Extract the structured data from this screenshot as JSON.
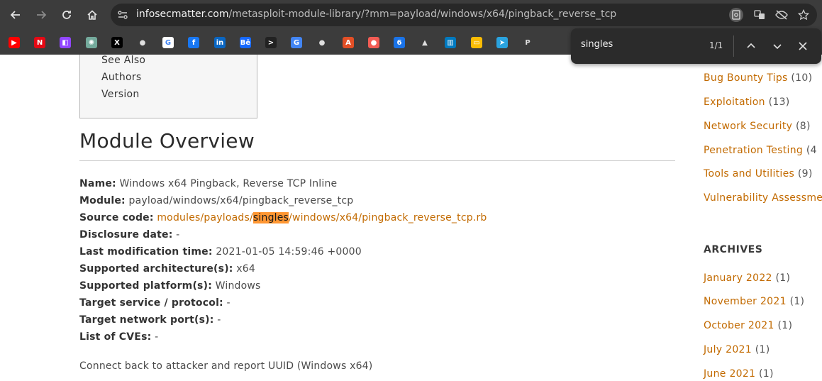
{
  "browser": {
    "url_host": "infosecmatter.com",
    "url_path": "/metasploit-module-library/?mm=payload/windows/x64/pingback_reverse_tcp",
    "bookmarks": [
      {
        "icon": "youtube-icon",
        "color": "#ff0000",
        "glyph": "▶"
      },
      {
        "icon": "netflix-icon",
        "color": "#e50914",
        "glyph": "N"
      },
      {
        "icon": "twitch-icon",
        "color": "#9146ff",
        "glyph": "◧"
      },
      {
        "icon": "chatgpt-icon",
        "color": "#74aa9c",
        "glyph": "✺"
      },
      {
        "icon": "x-icon",
        "color": "#000000",
        "glyph": "X"
      },
      {
        "icon": "apple-icon",
        "color": "#3c3c3c",
        "glyph": "●"
      },
      {
        "icon": "google-icon",
        "color": "#ffffff",
        "glyph": "G"
      },
      {
        "icon": "facebook-icon",
        "color": "#1877f2",
        "glyph": "f"
      },
      {
        "icon": "linkedin-icon",
        "color": "#0a66c2",
        "glyph": "in"
      },
      {
        "icon": "behance-icon",
        "color": "#1769ff",
        "glyph": "Bē"
      },
      {
        "icon": "prompt-icon",
        "color": "#222222",
        "glyph": ">"
      },
      {
        "icon": "translate-icon",
        "color": "#4285f4",
        "glyph": "G"
      },
      {
        "icon": "github-icon",
        "color": "#3c3c3c",
        "glyph": "●"
      },
      {
        "icon": "acrobat-icon",
        "color": "#e34f26",
        "glyph": "A"
      },
      {
        "icon": "screencast-icon",
        "color": "#f25c54",
        "glyph": "●"
      },
      {
        "icon": "calendar-icon",
        "color": "#1a73e8",
        "glyph": "6"
      },
      {
        "icon": "drive-icon",
        "color": "#3c3c3c",
        "glyph": "▲"
      },
      {
        "icon": "trello-icon",
        "color": "#0079bf",
        "glyph": "▥"
      },
      {
        "icon": "keep-icon",
        "color": "#fbbc04",
        "glyph": "▭"
      },
      {
        "icon": "telegram-icon",
        "color": "#2aa3df",
        "glyph": "➤"
      },
      {
        "icon": "paypal-icon",
        "color": "#3c3c3c",
        "glyph": "P"
      }
    ]
  },
  "toc": {
    "items": [
      "See Also",
      "Authors",
      "Version"
    ]
  },
  "overview": {
    "title": "Module Overview",
    "name_label": "Name:",
    "name_value": "Windows x64 Pingback, Reverse TCP Inline",
    "module_label": "Module:",
    "module_value": "payload/windows/x64/pingback_reverse_tcp",
    "source_label": "Source code:",
    "source_pre": "modules/payloads/",
    "source_highlight": "singles",
    "source_post": "/windows/x64/pingback_reverse_tcp.rb",
    "disclosure_label": "Disclosure date:",
    "disclosure_value": "-",
    "lastmod_label": "Last modification time:",
    "lastmod_value": "2021-01-05 14:59:46 +0000",
    "arch_label": "Supported architecture(s):",
    "arch_value": "x64",
    "platform_label": "Supported platform(s):",
    "platform_value": "Windows",
    "service_label": "Target service / protocol:",
    "service_value": "-",
    "port_label": "Target network port(s):",
    "port_value": "-",
    "cves_label": "List of CVEs:",
    "cves_value": "-",
    "description": "Connect back to attacker and report UUID (Windows x64)"
  },
  "sidebar": {
    "categories": [
      {
        "label": "Bug Bounty Tips",
        "count": "(10)"
      },
      {
        "label": "Exploitation",
        "count": "(13)"
      },
      {
        "label": "Network Security",
        "count": "(8)"
      },
      {
        "label": "Penetration Testing",
        "count": "(4"
      },
      {
        "label": "Tools and Utilities",
        "count": "(9)"
      },
      {
        "label": "Vulnerability Assessme",
        "count": ""
      }
    ],
    "archives_title": "ARCHIVES",
    "archives": [
      {
        "label": "January 2022",
        "count": "(1)"
      },
      {
        "label": "November 2021",
        "count": "(1)"
      },
      {
        "label": "October 2021",
        "count": "(1)"
      },
      {
        "label": "July 2021",
        "count": "(1)"
      },
      {
        "label": "June 2021",
        "count": "(1)"
      }
    ]
  },
  "findbar": {
    "query": "singles",
    "count": "1/1"
  },
  "colors": {
    "link": "#c26a00",
    "highlight": "#ff9632",
    "chrome": "#3c3c3c"
  }
}
